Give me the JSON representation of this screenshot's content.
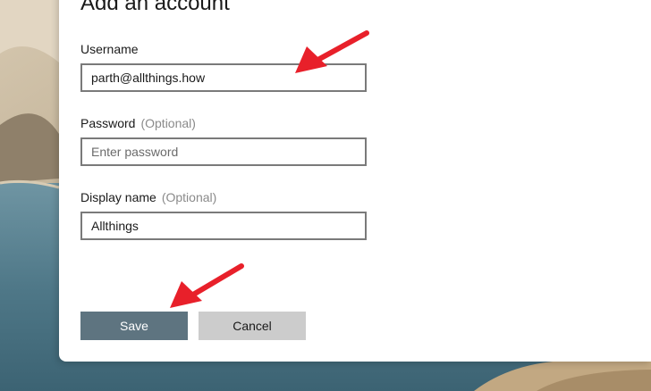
{
  "dialog": {
    "title": "Add an account",
    "username": {
      "label": "Username",
      "value": "parth@allthings.how"
    },
    "password": {
      "label": "Password",
      "optional": "(Optional)",
      "placeholder": "Enter password"
    },
    "display_name": {
      "label": "Display name",
      "optional": "(Optional)",
      "value": "Allthings"
    },
    "save_label": "Save",
    "cancel_label": "Cancel"
  },
  "colors": {
    "save_button": "#5e7480",
    "cancel_button": "#cccccc",
    "annotation_arrow": "#e8202a"
  },
  "icons": [
    "annotation-arrow-icon"
  ]
}
